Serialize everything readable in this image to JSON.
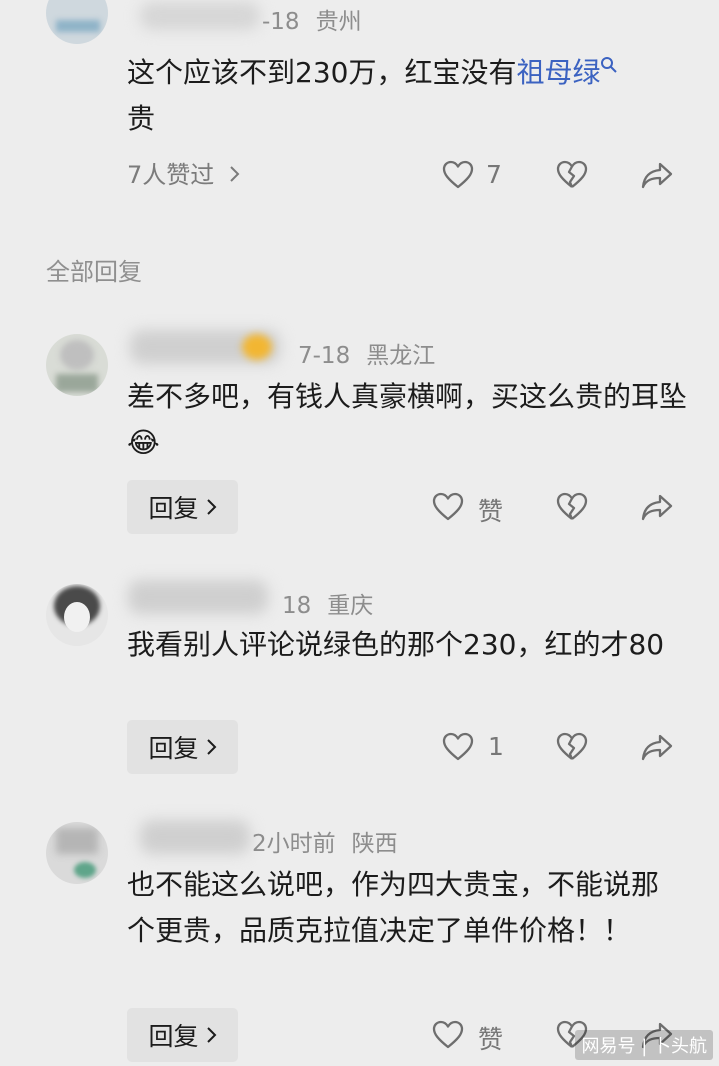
{
  "top_comment": {
    "date": "-18",
    "location": "贵州",
    "text_plain": "这个应该不到230万，红宝没有",
    "link_text": "祖母绿",
    "text_tail": "贵",
    "likes_link": "7人赞过",
    "like_count": "7"
  },
  "section_title": "全部回复",
  "replies": [
    {
      "name_visible": "晴",
      "date": "7-18",
      "location": "黑龙江",
      "text": "差不多吧，有钱人真豪横啊，买这么贵的耳坠",
      "emoji": "😂",
      "reply_label": "回复",
      "like_label": "赞"
    },
    {
      "name_visible": "",
      "date": "18",
      "location": "重庆",
      "text": "我看别人评论说绿色的那个230，红的才80",
      "reply_label": "回复",
      "like_label": "1"
    },
    {
      "name_visible": "",
      "date": "2小时前",
      "location": "陕西",
      "text": "也不能这么说吧，作为四大贵宝，不能说那个更贵，品质克拉值决定了单件价格！！",
      "reply_label": "回复",
      "like_label": "赞"
    }
  ],
  "icons": {
    "like": "heart-outline-icon",
    "dislike": "broken-heart-icon",
    "share": "share-arrow-icon",
    "chevron": "chevron-right-icon",
    "search": "search-icon"
  },
  "colors": {
    "background": "#ededed",
    "link": "#3b62c1",
    "meta": "#8d8d8d"
  },
  "watermark": "网易号 | 卜头航"
}
